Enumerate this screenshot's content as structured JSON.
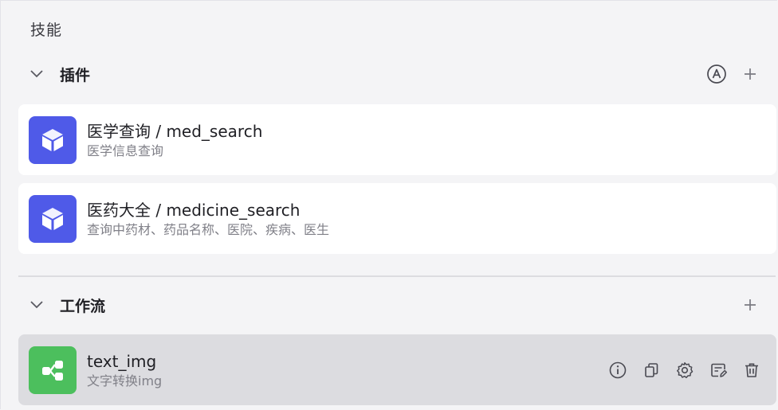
{
  "skills": {
    "title": "技能"
  },
  "plugins": {
    "label": "插件",
    "items": [
      {
        "title": "医学查询 / med_search",
        "desc": "医学信息查询"
      },
      {
        "title": "医药大全 / medicine_search",
        "desc": "查询中药材、药品名称、医院、疾病、医生"
      }
    ]
  },
  "workflows": {
    "label": "工作流",
    "items": [
      {
        "title": "text_img",
        "desc": "文字转换img"
      }
    ]
  },
  "colors": {
    "plugin_icon": "#4f5ae8",
    "workflow_icon": "#4cbf5d",
    "active_row": "#dcdce0"
  },
  "icons": {
    "collapse": "chevron-down-icon",
    "auto": "auto-mode-icon",
    "add": "plus-icon",
    "plugin": "cube-icon",
    "workflow": "workflow-nodes-icon",
    "info": "info-icon",
    "copy": "copy-icon",
    "settings": "gear-icon",
    "edit": "edit-icon",
    "delete": "trash-icon"
  }
}
